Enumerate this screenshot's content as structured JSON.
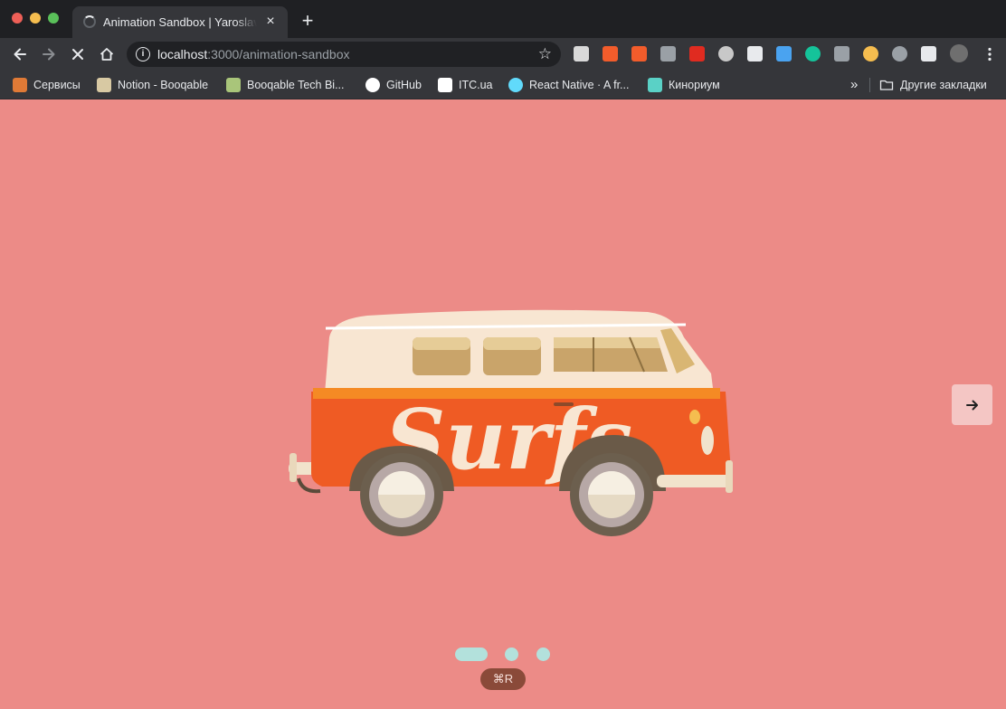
{
  "browser": {
    "tab_title": "Animation Sandbox | Yaroslav Valentyr",
    "tab_close_glyph": "×",
    "new_tab_glyph": "+",
    "url_host": "localhost",
    "url_path": ":3000/animation-sandbox",
    "star_glyph": "☆",
    "nav": {
      "back": "back-arrow-icon",
      "forward": "forward-arrow-icon",
      "stop": "stop-loading-icon",
      "home": "home-icon"
    },
    "extensions": [
      {
        "name": "reading-ext-icon",
        "color": "#d9d9d9"
      },
      {
        "name": "discount-ext-icon",
        "color": "#f25c2b"
      },
      {
        "name": "photo-ext-icon",
        "color": "#f25c2b"
      },
      {
        "name": "vue-devtools-icon",
        "color": "#9aa0a6"
      },
      {
        "name": "adblock-plus-icon",
        "color": "#e02b20"
      },
      {
        "name": "target-ext-icon",
        "color": "#c8c8c8"
      },
      {
        "name": "glasses-ext-icon",
        "color": "#e8eaed"
      },
      {
        "name": "folder-ext-icon",
        "color": "#4aa3f0"
      },
      {
        "name": "grammarly-icon",
        "color": "#15c39a"
      },
      {
        "name": "github-ext-icon",
        "color": "#9aa0a6"
      },
      {
        "name": "eye-ext-icon",
        "color": "#f5bd4f"
      },
      {
        "name": "power-ext-icon",
        "color": "#9aa0a6"
      },
      {
        "name": "puzzle-extensions-icon",
        "color": "#e8eaed"
      },
      {
        "name": "profile-avatar",
        "color": "#6f6f6f"
      }
    ]
  },
  "bookmarks": {
    "items": [
      {
        "label": "Сервисы",
        "icon": "apps-grid-icon",
        "color": "#e07a36"
      },
      {
        "label": "Notion - Booqable",
        "icon": "notion-icon",
        "color": "#d8c9a3"
      },
      {
        "label": "Booqable Tech Bi...",
        "icon": "books-icon",
        "color": "#a9c57a"
      },
      {
        "label": "GitHub",
        "icon": "github-icon",
        "color": "#ffffff"
      },
      {
        "label": "ITC.ua",
        "icon": "itc-icon",
        "color": "#ffffff"
      },
      {
        "label": "React Native · A fr...",
        "icon": "react-icon",
        "color": "#61dafb"
      },
      {
        "label": "Кинориум",
        "icon": "kinorium-icon",
        "color": "#5ad1c6"
      }
    ],
    "more_glyph": "»",
    "other_label": "Другие закладки"
  },
  "page": {
    "background": "#ec8b87",
    "van_text": "Surfs",
    "next_button": "→",
    "slider": {
      "total": 3,
      "active": 1
    },
    "shortcut_hint": "⌘R"
  }
}
